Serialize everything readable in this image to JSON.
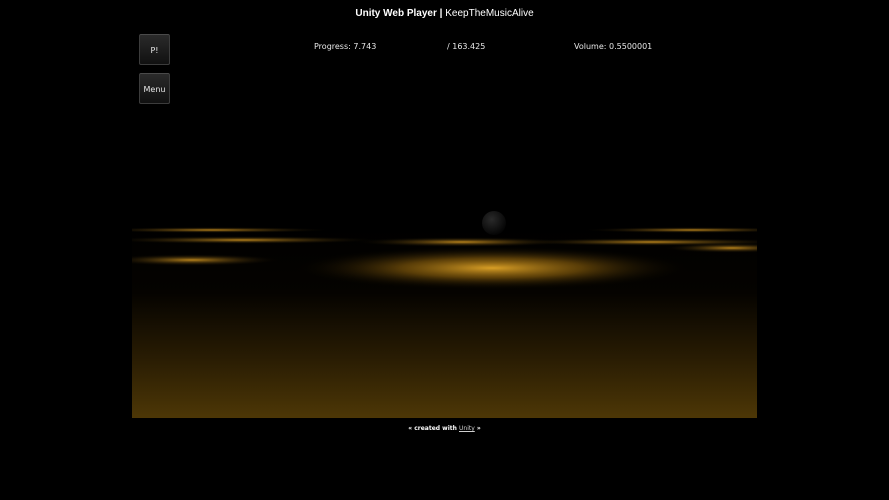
{
  "header": {
    "app_name": "Unity Web Player",
    "separator": "|",
    "game_title": "KeepTheMusicAlive"
  },
  "player": {
    "buttons": {
      "p_label": "P!",
      "menu_label": "Menu"
    },
    "hud": {
      "progress_label": "Progress:",
      "progress_value": "7.743",
      "total_text": "/ 163.425",
      "volume_label": "Volume:",
      "volume_value": "0.5500001"
    }
  },
  "footer": {
    "prefix": "« created with",
    "link": "Unity",
    "suffix": "»"
  },
  "colors": {
    "background": "#000000",
    "glow": "#e0a020",
    "floor": "#4a3505"
  }
}
